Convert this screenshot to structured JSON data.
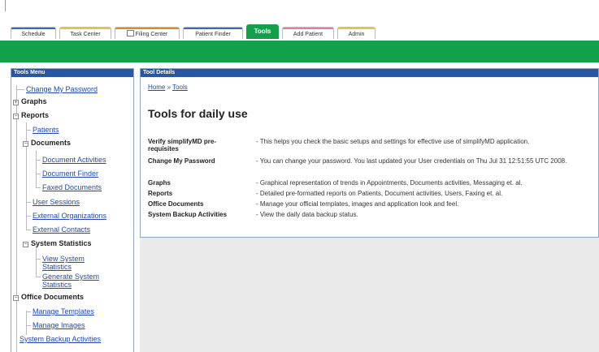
{
  "tabs": [
    {
      "label": "Schedule",
      "color": "#3a6ab7",
      "w": 56
    },
    {
      "label": "Task Center",
      "color": "#e6c44a",
      "w": 64
    },
    {
      "label": "Filing Center",
      "color": "#d88a2a",
      "w": 80,
      "icon": "folder-icon"
    },
    {
      "label": "Patient Finder",
      "color": "#3a6ab7",
      "w": 74
    },
    {
      "label": "Tools",
      "color": "#12a14a",
      "w": 40,
      "active": true
    },
    {
      "label": "Add Patient",
      "color": "#e07aa8",
      "w": 64
    },
    {
      "label": "Admin",
      "color": "#e6c44a",
      "w": 47
    }
  ],
  "menu": {
    "title": "Tools Menu",
    "items": {
      "change_password": "Change My Password",
      "graphs": "Graphs",
      "reports": "Reports",
      "patients": "Patients",
      "documents": "Documents",
      "document_activities": "Document Activities",
      "document_finder": "Document Finder",
      "faxed_documents": "Faxed Documents",
      "user_sessions": "User Sessions",
      "external_organizations": "External Organizations",
      "external_contacts": "External Contacts",
      "system_statistics": "System Statistics",
      "view_system_statistics": "View System Statistics",
      "generate_system_statistics": "Generate System Statistics",
      "office_documents": "Office Documents",
      "manage_templates": "Manage Templates",
      "manage_images": "Manage Images",
      "system_backup_activities": "System Backup Activities"
    },
    "expanders": {
      "plus": "+",
      "minus": "−"
    }
  },
  "details": {
    "title": "Tool Details",
    "breadcrumb": {
      "home": "Home",
      "sep": "»",
      "current": "Tools"
    },
    "page_title": "Tools for daily use",
    "rows": [
      {
        "label": "Verify simplifyMD pre-requisites",
        "desc": "- This helps you check the basic setups and settings for effective use of simplifyMD application."
      },
      {
        "label": "Change My Password",
        "desc": "- You can change your password. You last updated your User credentials on Thu Jul 31 12:51:55 UTC 2008."
      },
      {
        "label": "Graphs",
        "desc": "- Graphical representation of trends in Appointments, Documents activities, Messaging et. al."
      },
      {
        "label": "Reports",
        "desc": "- Detailed pre-formatted reports on Patients, Document activities, Users, Faxing et. al."
      },
      {
        "label": "Office Documents",
        "desc": "- Manage your official templates, images and application look and feel."
      },
      {
        "label": "System Backup Activities",
        "desc": "- View the daily data backup status."
      }
    ]
  }
}
